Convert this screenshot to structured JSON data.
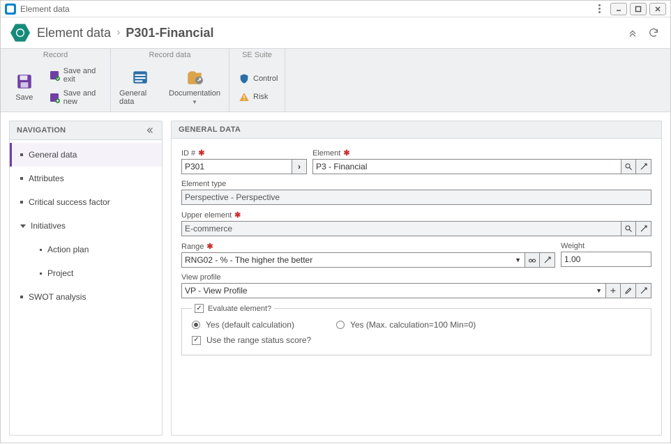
{
  "titlebar": {
    "title": "Element data"
  },
  "breadcrumb": {
    "section": "Element data",
    "current": "P301-Financial"
  },
  "toolbar": {
    "groups": {
      "record": {
        "header": "Record",
        "save": "Save",
        "save_exit": "Save and exit",
        "save_new": "Save and new"
      },
      "record_data": {
        "header": "Record data",
        "general_data": "General data",
        "documentation": "Documentation"
      },
      "se_suite": {
        "header": "SE Suite",
        "control": "Control",
        "risk": "Risk"
      }
    }
  },
  "navigation": {
    "header": "NAVIGATION",
    "items": {
      "general_data": "General data",
      "attributes": "Attributes",
      "csf": "Critical success factor",
      "initiatives": "Initiatives",
      "action_plan": "Action plan",
      "project": "Project",
      "swot": "SWOT analysis"
    }
  },
  "form": {
    "header": "GENERAL DATA",
    "id": {
      "label": "ID #",
      "value": "P301"
    },
    "element": {
      "label": "Element",
      "value": "P3 - Financial"
    },
    "element_type": {
      "label": "Element type",
      "value": "Perspective - Perspective"
    },
    "upper_element": {
      "label": "Upper element",
      "value": "E-commerce"
    },
    "range": {
      "label": "Range",
      "value": "RNG02 - % - The higher the better"
    },
    "weight": {
      "label": "Weight",
      "value": "1.00"
    },
    "view_profile": {
      "label": "View profile",
      "value": "VP - View Profile"
    },
    "evaluate": {
      "legend": "Evaluate element?",
      "opt_default": "Yes (default calculation)",
      "opt_maxmin": "Yes (Max. calculation=100 Min=0)",
      "use_range": "Use the range status score?"
    }
  }
}
